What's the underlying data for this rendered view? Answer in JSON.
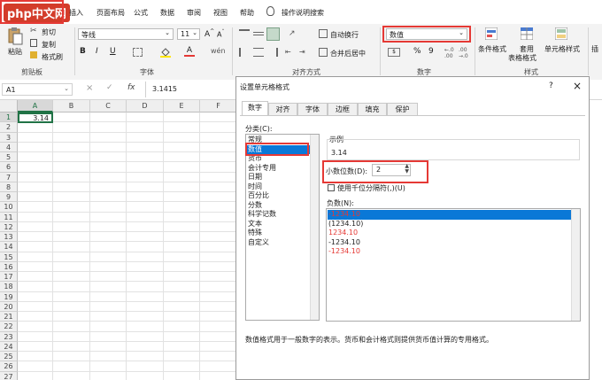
{
  "colors": {
    "accent": "#217346",
    "red_highlight": "#e53935",
    "selection": "#0a78d7",
    "negative": "#e53935"
  },
  "logo": {
    "text": "php中文网"
  },
  "tabs": [
    "插入",
    "页面布局",
    "公式",
    "数据",
    "审阅",
    "视图",
    "帮助"
  ],
  "tell_me": "操作说明搜索",
  "ribbon": {
    "clipboard": {
      "paste": "粘贴",
      "cut": "剪切",
      "copy": "复制",
      "format_painter": "格式刷",
      "label": "剪贴板"
    },
    "font": {
      "name": "等线",
      "size": "11",
      "bold": "B",
      "italic": "I",
      "underline": "U",
      "label": "字体",
      "wen": "wén"
    },
    "alignment": {
      "wrap": "自动换行",
      "merge": "合并后居中",
      "label": "对齐方式"
    },
    "number": {
      "format": "数值",
      "label": "数字",
      "percent": "%",
      "comma": "9"
    },
    "styles": {
      "conditional": "条件格式",
      "table_format_1": "套用",
      "table_format_2": "表格格式",
      "cell_styles": "单元格样式",
      "label": "样式",
      "insert": "插"
    }
  },
  "formula_bar": {
    "name_box": "A1",
    "fx": "fx",
    "content": "3.1415",
    "cancel": "×",
    "enter": "✓"
  },
  "grid": {
    "columns": [
      "A",
      "B",
      "C",
      "D",
      "E",
      "F"
    ],
    "rows": [
      "1",
      "2",
      "3",
      "4",
      "5",
      "6",
      "7",
      "8",
      "9",
      "10",
      "11",
      "12",
      "13",
      "14",
      "15",
      "16",
      "17",
      "18",
      "19",
      "20",
      "21",
      "22",
      "23",
      "24",
      "25",
      "26",
      "27",
      "28"
    ],
    "a1_display": "3.14"
  },
  "dialog": {
    "title": "设置单元格格式",
    "help": "?",
    "close": "×",
    "tabs": [
      "数字",
      "对齐",
      "字体",
      "边框",
      "填充",
      "保护"
    ],
    "category_label": "分类(C):",
    "categories": [
      "常规",
      "数值",
      "货币",
      "会计专用",
      "日期",
      "时间",
      "百分比",
      "分数",
      "科学记数",
      "文本",
      "特殊",
      "自定义"
    ],
    "selected_category": "数值",
    "sample_label": "示例",
    "sample_value": "3.14",
    "decimal_label": "小数位数(D):",
    "decimal_value": "2",
    "thousands_label": "使用千位分隔符(,)(U)",
    "negative_label": "负数(N):",
    "negative_formats": [
      {
        "text": "-1234.10",
        "selected": true,
        "red": false
      },
      {
        "text": "(1234.10)",
        "selected": false,
        "red": false
      },
      {
        "text": "1234.10",
        "selected": false,
        "red": true
      },
      {
        "text": "-1234.10",
        "selected": false,
        "red": false
      },
      {
        "text": "-1234.10",
        "selected": false,
        "red": true
      }
    ],
    "description": "数值格式用于一般数字的表示。货币和会计格式则提供货币值计算的专用格式。"
  }
}
